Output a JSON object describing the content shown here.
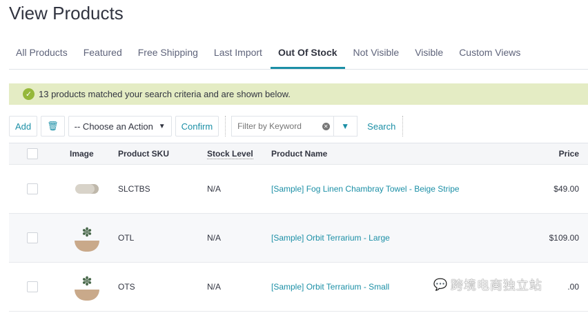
{
  "title": "View Products",
  "tabs": [
    "All Products",
    "Featured",
    "Free Shipping",
    "Last Import",
    "Out Of Stock",
    "Not Visible",
    "Visible",
    "Custom Views"
  ],
  "active_tab": "Out Of Stock",
  "alert": "13 products matched your search criteria and are shown below.",
  "toolbar": {
    "add": "Add",
    "action": "-- Choose an Action",
    "confirm": "Confirm",
    "filter_placeholder": "Filter by Keyword",
    "search": "Search"
  },
  "columns": {
    "image": "Image",
    "sku": "Product SKU",
    "stock": "Stock Level",
    "name": "Product Name",
    "price": "Price"
  },
  "rows": [
    {
      "sku": "SLCTBS",
      "stock": "N/A",
      "name": "[Sample] Fog Linen Chambray Towel - Beige Stripe",
      "price": "$49.00"
    },
    {
      "sku": "OTL",
      "stock": "N/A",
      "name": "[Sample] Orbit Terrarium - Large",
      "price": "$109.00"
    },
    {
      "sku": "OTS",
      "stock": "N/A",
      "name": "[Sample] Orbit Terrarium - Small",
      "price": ".00"
    }
  ],
  "watermark": "跨境电商独立站",
  "colors": {
    "accent": "#1b8fa6",
    "alert_bg": "#e4ecc4",
    "success": "#95b83a"
  }
}
